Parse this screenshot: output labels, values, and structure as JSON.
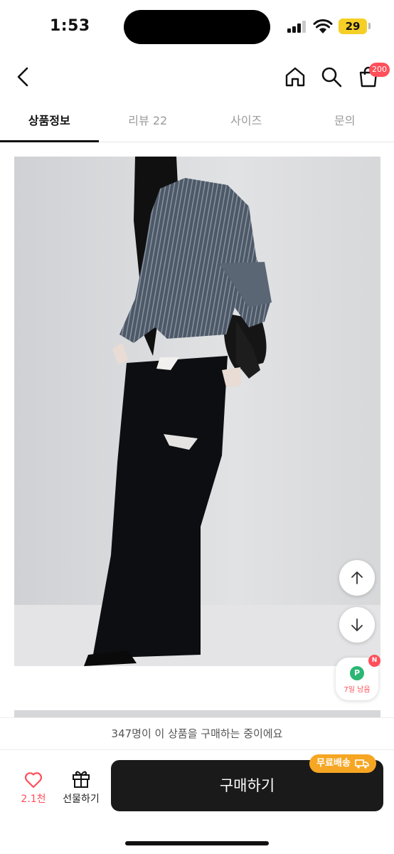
{
  "status_bar": {
    "time": "1:53",
    "battery": "29"
  },
  "header": {
    "cart_count": "200"
  },
  "tabs": [
    {
      "label": "상품정보",
      "active": true
    },
    {
      "label": "리뷰 22",
      "active": false
    },
    {
      "label": "사이즈",
      "active": false
    },
    {
      "label": "문의",
      "active": false
    }
  ],
  "point_widget": {
    "icon_letter": "P",
    "new_badge": "N",
    "label": "7일 남음"
  },
  "purchase_notice": "347명이 이 상품을 구매하는 중이에요",
  "bottom_bar": {
    "like_count": "2.1천",
    "gift_label": "선물하기",
    "buy_label": "구매하기",
    "shipping_badge": "무료배송"
  },
  "colors": {
    "accent_red": "#ff4f5a",
    "buy_button": "#1a1a1a",
    "shipping_orange": "#f6a623",
    "point_green": "#2bb673"
  },
  "icons": [
    "back-icon",
    "home-icon",
    "search-icon",
    "shopping-bag-icon",
    "arrow-up-icon",
    "arrow-down-icon",
    "heart-icon",
    "gift-icon",
    "truck-icon"
  ]
}
